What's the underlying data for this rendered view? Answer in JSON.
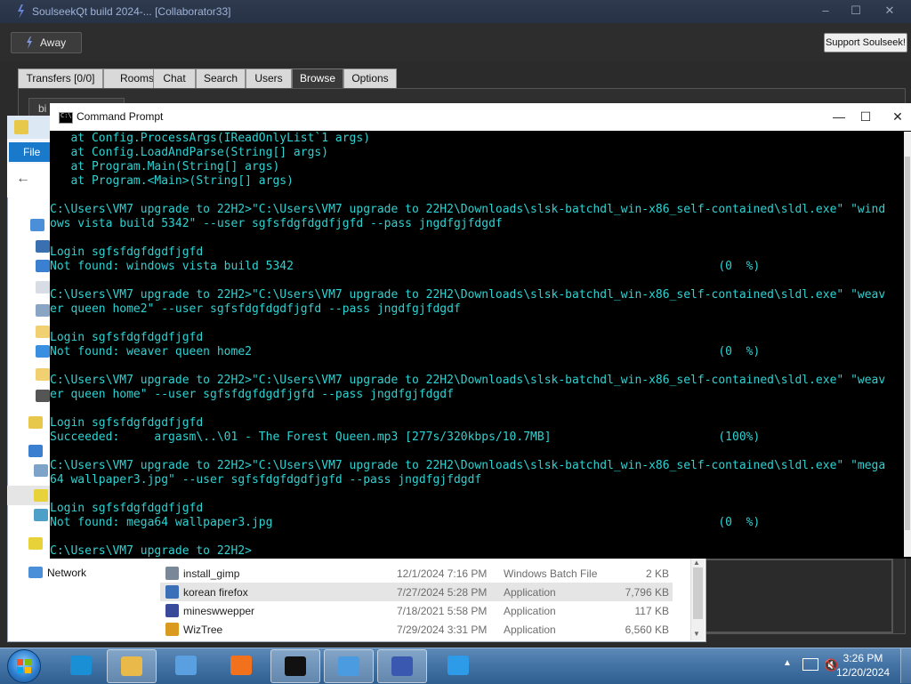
{
  "soulseek": {
    "title": "SoulseekQt build 2024-... [Collaborator33]",
    "away_label": "Away",
    "support_label": "Support Soulseek!",
    "tabs": [
      {
        "label": "Transfers [0/0]"
      },
      {
        "label": "Rooms"
      },
      {
        "label": "Chat"
      },
      {
        "label": "Search"
      },
      {
        "label": "Users"
      },
      {
        "label": "Browse"
      },
      {
        "label": "Options"
      }
    ],
    "active_tab": "Browse",
    "inner_label": "bi"
  },
  "explorer": {
    "file_tab": "File",
    "network_label": "Network",
    "files": [
      {
        "name": "install_gimp",
        "date": "12/1/2024 7:16 PM",
        "type": "Windows Batch File",
        "size": "2 KB",
        "icon": "batch-file-icon",
        "color": "#7a8796"
      },
      {
        "name": "korean firefox",
        "date": "7/27/2024 5:28 PM",
        "type": "Application",
        "size": "7,796 KB",
        "icon": "application-icon",
        "color": "#3b6fb8"
      },
      {
        "name": "mineswwepper",
        "date": "7/18/2021 5:58 PM",
        "type": "Application",
        "size": "117 KB",
        "icon": "minesweeper-icon",
        "color": "#3a4a9a"
      },
      {
        "name": "WizTree",
        "date": "7/29/2024 3:31 PM",
        "type": "Application",
        "size": "6,560 KB",
        "icon": "wiztree-icon",
        "color": "#d99a1f"
      }
    ]
  },
  "cmd": {
    "title": "Command Prompt",
    "lines": [
      "   at Config.ProcessArgs(IReadOnlyList`1 args)",
      "   at Config.LoadAndParse(String[] args)",
      "   at Program.Main(String[] args)",
      "   at Program.<Main>(String[] args)",
      "",
      "C:\\Users\\VM7 upgrade to 22H2>\"C:\\Users\\VM7 upgrade to 22H2\\Downloads\\slsk-batchdl_win-x86_self-contained\\sldl.exe\" \"wind",
      "ows vista build 5342\" --user sgfsfdgfdgdfjgfd --pass jngdfgjfdgdf",
      "",
      "Login sgfsfdgfdgdfjgfd",
      "Not found: windows vista build 5342                                                             (0  %)",
      "",
      "C:\\Users\\VM7 upgrade to 22H2>\"C:\\Users\\VM7 upgrade to 22H2\\Downloads\\slsk-batchdl_win-x86_self-contained\\sldl.exe\" \"weav",
      "er queen home2\" --user sgfsfdgfdgdfjgfd --pass jngdfgjfdgdf",
      "",
      "Login sgfsfdgfdgdfjgfd",
      "Not found: weaver queen home2                                                                   (0  %)",
      "",
      "C:\\Users\\VM7 upgrade to 22H2>\"C:\\Users\\VM7 upgrade to 22H2\\Downloads\\slsk-batchdl_win-x86_self-contained\\sldl.exe\" \"weav",
      "er queen home\" --user sgfsfdgfdgdfjgfd --pass jngdfgjfdgdf",
      "",
      "Login sgfsfdgfdgdfjgfd",
      "Succeeded:     argasm\\..\\01 - The Forest Queen.mp3 [277s/320kbps/10.7MB]                        (100%)",
      "",
      "C:\\Users\\VM7 upgrade to 22H2>\"C:\\Users\\VM7 upgrade to 22H2\\Downloads\\slsk-batchdl_win-x86_self-contained\\sldl.exe\" \"mega",
      "64 wallpaper3.jpg\" --user sgfsfdgfdgdfjgfd --pass jngdfgjfdgdf",
      "",
      "Login sgfsfdgfdgdfjgfd",
      "Not found: mega64 wallpaper3.jpg                                                                (0  %)",
      "",
      "C:\\Users\\VM7 upgrade to 22H2>"
    ]
  },
  "taskbar": {
    "items": [
      {
        "name": "edge-icon",
        "color": "#1b8fd6",
        "active": false
      },
      {
        "name": "file-explorer-icon",
        "color": "#e9b949",
        "active": true
      },
      {
        "name": "store-icon",
        "color": "#5aa0e0",
        "active": false
      },
      {
        "name": "firefox-icon",
        "color": "#f2711c",
        "active": false
      },
      {
        "name": "command-prompt-icon",
        "color": "#111111",
        "active": true
      },
      {
        "name": "windows7-icon",
        "color": "#4b9be0",
        "active": true
      },
      {
        "name": "soulseek-icon",
        "color": "#3b58b0",
        "active": true
      },
      {
        "name": "internet-explorer-icon",
        "color": "#2e9be8",
        "active": false
      }
    ],
    "time": "3:26 PM",
    "date": "12/20/2024"
  },
  "colors": {
    "console_text": "#2fd2d2",
    "selection": "#e5e5e5"
  }
}
